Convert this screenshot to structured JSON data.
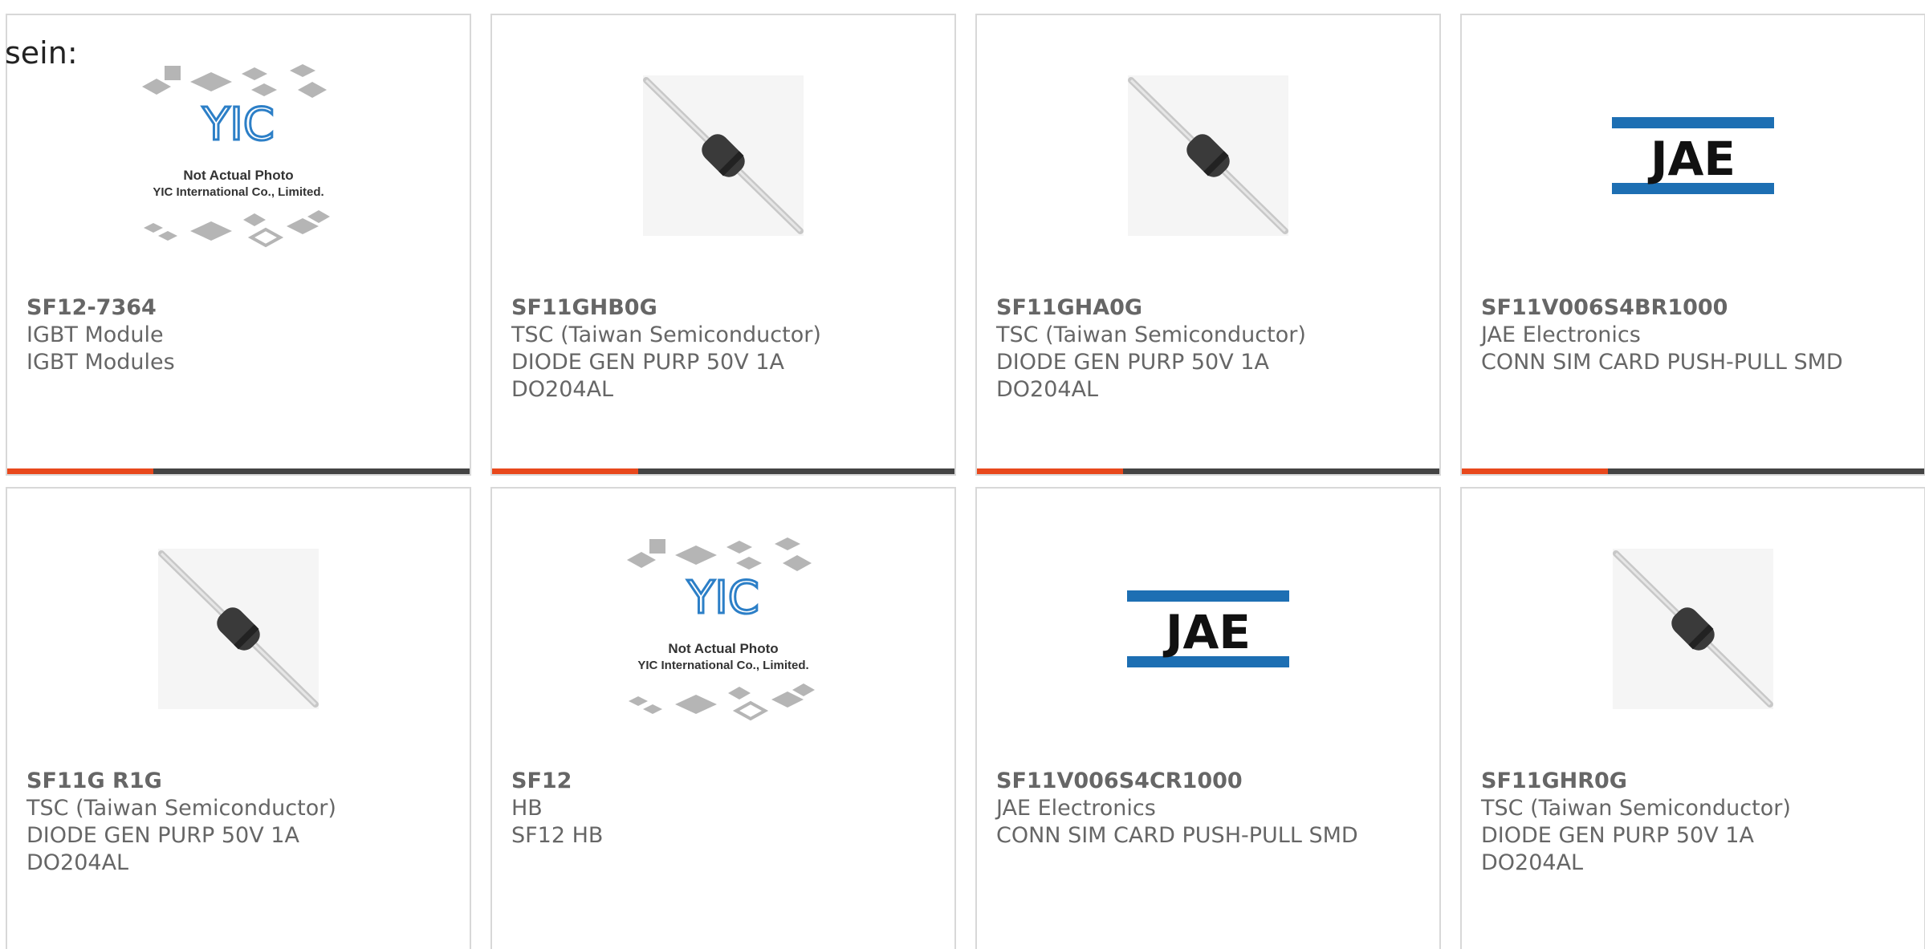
{
  "intro_text": "sein:",
  "colors": {
    "accent": "#e8481c",
    "bar": "#444444",
    "jae_blue": "#1d6fb3"
  },
  "cards": [
    {
      "part": "SF12-7364",
      "line1": "IGBT Module",
      "line2": "IGBT Modules",
      "line3": "",
      "image": "yic-placeholder",
      "placeholder_line1": "Not Actual Photo",
      "placeholder_line2": "YIC International Co., Limited."
    },
    {
      "part": "SF11GHB0G",
      "line1": "TSC (Taiwan Semiconductor)",
      "line2": "DIODE GEN PURP 50V 1A",
      "line3": "DO204AL",
      "image": "diode-photo"
    },
    {
      "part": "SF11GHA0G",
      "line1": "TSC (Taiwan Semiconductor)",
      "line2": "DIODE GEN PURP 50V 1A",
      "line3": "DO204AL",
      "image": "diode-photo"
    },
    {
      "part": "SF11V006S4BR1000",
      "line1": "JAE Electronics",
      "line2": "CONN SIM CARD PUSH-PULL SMD",
      "line3": "",
      "image": "jae-logo",
      "logo_text": "JAE"
    },
    {
      "part": "SF11G R1G",
      "line1": "TSC (Taiwan Semiconductor)",
      "line2": "DIODE GEN PURP 50V 1A",
      "line3": "DO204AL",
      "image": "diode-photo"
    },
    {
      "part": "SF12",
      "line1": "HB",
      "line2": "SF12 HB",
      "line3": "",
      "image": "yic-placeholder",
      "placeholder_line1": "Not Actual Photo",
      "placeholder_line2": "YIC International Co., Limited."
    },
    {
      "part": "SF11V006S4CR1000",
      "line1": "JAE Electronics",
      "line2": "CONN SIM CARD PUSH-PULL SMD",
      "line3": "",
      "image": "jae-logo",
      "logo_text": "JAE"
    },
    {
      "part": "SF11GHR0G",
      "line1": "TSC (Taiwan Semiconductor)",
      "line2": "DIODE GEN PURP 50V 1A",
      "line3": "DO204AL",
      "image": "diode-photo"
    }
  ]
}
